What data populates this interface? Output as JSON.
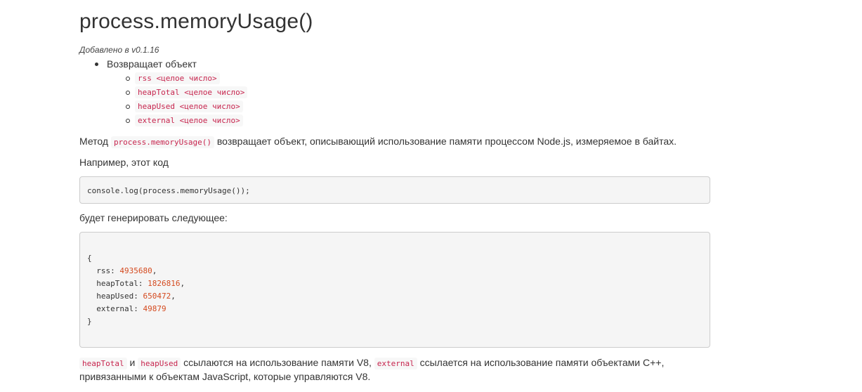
{
  "heading": "process.memoryUsage()",
  "added_in": "Добавлено в v0.1.16",
  "returns": {
    "label": "Возвращает объект",
    "items": [
      "rss <целое число>",
      "heapTotal <целое число>",
      "heapUsed <целое число>",
      "external <целое число>"
    ]
  },
  "paragraph1": {
    "before": "Метод",
    "code": "process.memoryUsage()",
    "after": "возвращает объект, описывающий использование памяти процессом Node.js, измеряемое в байтах."
  },
  "paragraph2": "Например, этот код",
  "code_example": "console.log(process.memoryUsage());",
  "paragraph3": "будет генерировать следующее:",
  "output": {
    "open_brace": "{",
    "close_brace": "}",
    "lines": [
      {
        "key": "  rss: ",
        "value": "4935680",
        "suffix": ","
      },
      {
        "key": "  heapTotal: ",
        "value": "1826816",
        "suffix": ","
      },
      {
        "key": "  heapUsed: ",
        "value": "650472",
        "suffix": ","
      },
      {
        "key": "  external: ",
        "value": "49879",
        "suffix": ""
      }
    ]
  },
  "paragraph4": {
    "code1": "heapTotal",
    "text1": "и",
    "code2": "heapUsed",
    "text2": "ссылаются на использование памяти V8,",
    "code3": "external",
    "text3": "ссылается на использование памяти объектами C++,",
    "line2": "привязанными к объектам JavaScript, которые управляются V8."
  },
  "colors": {
    "text": "#333333",
    "inline_code": "#c7254e",
    "number": "#d44a1f",
    "code_block_bg": "#f5f5f5"
  }
}
